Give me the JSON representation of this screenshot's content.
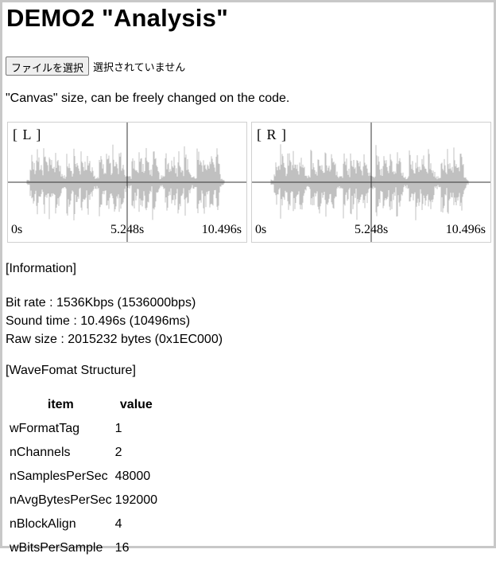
{
  "title": "DEMO2 \"Analysis\"",
  "file": {
    "button_label": "ファイルを選択",
    "status": "選択されていません"
  },
  "canvas_note": "\"Canvas\" size, can be freely changed on the code.",
  "channels": [
    {
      "label": "[ L ]",
      "time_start": "0s",
      "time_mid": "5.248s",
      "time_end": "10.496s",
      "wave_color": "#c0c0c0"
    },
    {
      "label": "[ R ]",
      "time_start": "0s",
      "time_mid": "5.248s",
      "time_end": "10.496s",
      "wave_color": "#c0c0c0"
    }
  ],
  "information": {
    "heading": "[Information]",
    "bit_rate": "Bit rate : 1536Kbps (1536000bps)",
    "sound_time": "Sound time : 10.496s (10496ms)",
    "raw_size": "Raw size : 2015232 bytes (0x1EC000)"
  },
  "wave_format": {
    "heading": "[WaveFomat Structure]",
    "col_item": "item",
    "col_value": "value",
    "rows": [
      {
        "item": "wFormatTag",
        "value": "1"
      },
      {
        "item": "nChannels",
        "value": "2"
      },
      {
        "item": "nSamplesPerSec",
        "value": "48000"
      },
      {
        "item": "nAvgBytesPerSec",
        "value": "192000"
      },
      {
        "item": "nBlockAlign",
        "value": "4"
      },
      {
        "item": "wBitsPerSample",
        "value": "16"
      }
    ]
  }
}
